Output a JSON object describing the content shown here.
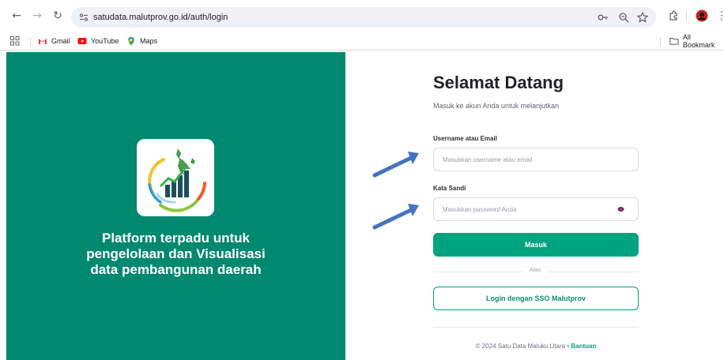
{
  "browser": {
    "url": "satudata.malutprov.go.id/auth/login",
    "bookmarks": [
      {
        "label": "Gmail",
        "icon": "gmail-icon"
      },
      {
        "label": "YouTube",
        "icon": "youtube-icon"
      },
      {
        "label": "Maps",
        "icon": "maps-icon"
      }
    ],
    "all_bookmarks_label": "All Bookmark",
    "icons": [
      "back-icon",
      "forward-icon",
      "reload-icon",
      "site-settings-icon",
      "key-icon",
      "zoom-icon",
      "star-icon",
      "extensions-icon",
      "profile-avatar",
      "menu-icon",
      "apps-icon",
      "folder-icon"
    ]
  },
  "left": {
    "bg_color": "#00896f",
    "tagline_lines": [
      "Platform terpadu untuk",
      "pengelolaan dan Visualisasi",
      "data pembangunan daerah"
    ]
  },
  "form": {
    "title": "Selamat Datang",
    "subtitle": "Masuk ke akun Anda untuk melanjutkan",
    "username_label": "Username atau Email",
    "username_placeholder": "Masukkan username atau email",
    "password_label": "Kata Sandi",
    "password_placeholder": "Masukkan password Anda",
    "submit_label": "Masuk",
    "divider_text": "Atau",
    "sso_label": "Login dengan SSO Malutprov",
    "accent_color": "#00a37f"
  },
  "footer": {
    "text": "© 2024 Satu Data Maluku Utara •",
    "help_link": "Bantuan"
  }
}
